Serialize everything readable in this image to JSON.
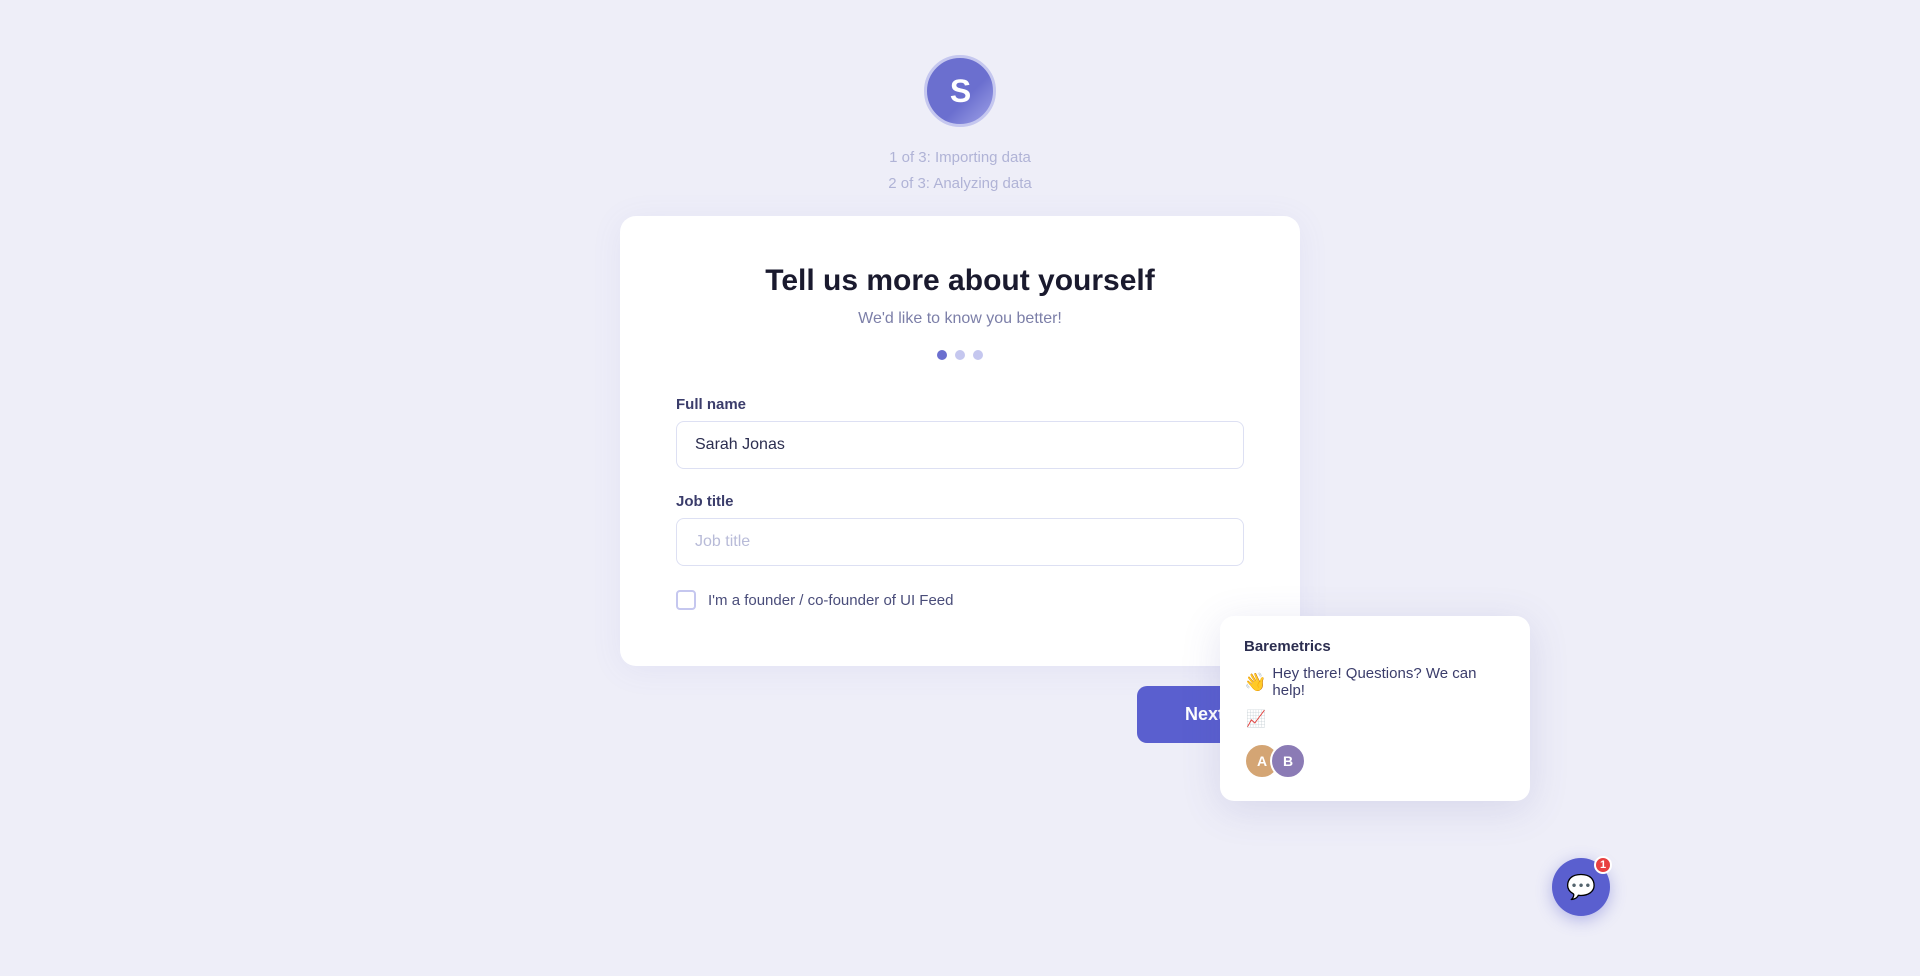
{
  "logo": {
    "letter": "S"
  },
  "progress": {
    "step1": "1 of 3: Importing data",
    "step2": "2 of 3: Analyzing data"
  },
  "card": {
    "title": "Tell us more about yourself",
    "subtitle": "We'd like to know you better!",
    "dots": [
      {
        "active": true
      },
      {
        "active": false
      },
      {
        "active": false
      }
    ]
  },
  "form": {
    "full_name_label": "Full name",
    "full_name_value": "Sarah Jonas",
    "full_name_placeholder": "Full name",
    "job_title_label": "Job title",
    "job_title_value": "",
    "job_title_placeholder": "Job title",
    "checkbox_label": "I'm a founder / co-founder of UI Feed"
  },
  "buttons": {
    "next_label": "Next"
  },
  "chat": {
    "brand": "Baremetrics",
    "greeting_emoji": "👋",
    "message": "Hey there!  Questions? We can help!",
    "chart_icon": "📈",
    "badge_count": "1"
  }
}
